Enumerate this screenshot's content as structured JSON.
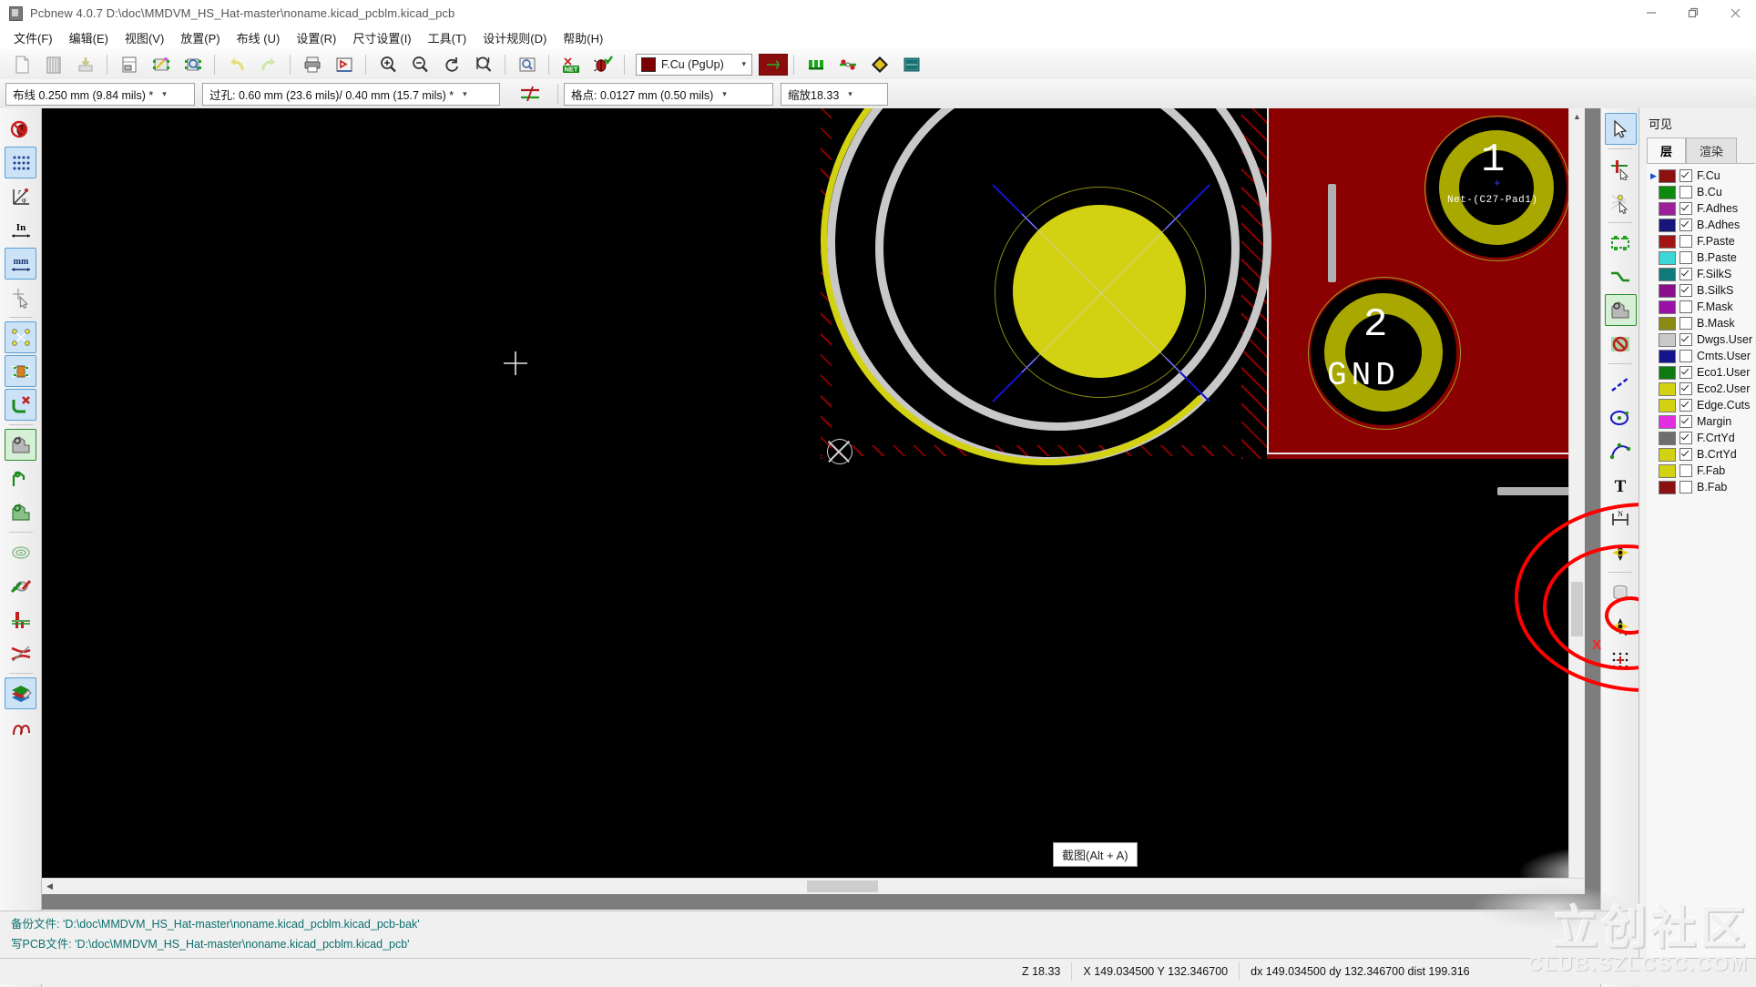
{
  "window": {
    "title": "Pcbnew 4.0.7 D:\\doc\\MMDVM_HS_Hat-master\\noname.kicad_pcblm.kicad_pcb",
    "app_icon": "pcbnew-icon",
    "buttons": [
      {
        "name": "minimize-button",
        "glyph": "minimize-icon"
      },
      {
        "name": "maximize-button",
        "glyph": "restore-icon"
      },
      {
        "name": "close-button",
        "glyph": "close-icon"
      }
    ]
  },
  "menubar": {
    "items": [
      {
        "label": "文件(F)",
        "name": "menu-file"
      },
      {
        "label": "编辑(E)",
        "name": "menu-edit"
      },
      {
        "label": "视图(V)",
        "name": "menu-view"
      },
      {
        "label": "放置(P)",
        "name": "menu-place"
      },
      {
        "label": "布线 (U)",
        "name": "menu-route"
      },
      {
        "label": "设置(R)",
        "name": "menu-preferences"
      },
      {
        "label": "尺寸设置(I)",
        "name": "menu-dimensions"
      },
      {
        "label": "工具(T)",
        "name": "menu-tools"
      },
      {
        "label": "设计规则(D)",
        "name": "menu-design-rules"
      },
      {
        "label": "帮助(H)",
        "name": "menu-help"
      }
    ]
  },
  "toolbar_main": {
    "buttons": [
      {
        "name": "new-board-button",
        "icon": "new-page-icon"
      },
      {
        "name": "open-board-button",
        "icon": "open-board-icon"
      },
      {
        "name": "save-board-button",
        "icon": "save-icon"
      },
      {
        "name": "page-settings-button",
        "icon": "page-settings-icon"
      },
      {
        "name": "open-module-editor-button",
        "icon": "module-editor-icon"
      },
      {
        "name": "open-module-viewer-button",
        "icon": "module-viewer-icon"
      },
      {
        "name": "undo-button",
        "icon": "undo-arrow-icon"
      },
      {
        "name": "redo-button",
        "icon": "redo-arrow-icon"
      },
      {
        "name": "print-button",
        "icon": "printer-icon"
      },
      {
        "name": "plot-button",
        "icon": "plot-icon"
      },
      {
        "name": "zoom-in-button",
        "icon": "zoom-in-icon"
      },
      {
        "name": "zoom-out-button",
        "icon": "zoom-out-icon"
      },
      {
        "name": "zoom-redraw-button",
        "icon": "refresh-icon"
      },
      {
        "name": "zoom-fit-button",
        "icon": "zoom-fit-icon"
      },
      {
        "name": "find-button",
        "icon": "magnifier-icon"
      },
      {
        "name": "netlist-button",
        "icon": "netlist-icon"
      },
      {
        "name": "drc-button",
        "icon": "drc-bug-icon"
      }
    ],
    "layer_selector": {
      "name": "active-layer-selector",
      "value": "F.Cu (PgUp)",
      "swatch_color": "#7c0000"
    },
    "via_color_button": {
      "name": "via-color-button",
      "color": "#8a0d0d"
    },
    "extra_buttons": [
      {
        "name": "mode-module-button",
        "icon": "module-mode-icon"
      },
      {
        "name": "mode-track-button",
        "icon": "track-mode-icon"
      },
      {
        "name": "highcontrast-button",
        "icon": "high-contrast-icon"
      },
      {
        "name": "show-ratsnest-button",
        "icon": "ratsnest-icon"
      }
    ]
  },
  "toolbar_aux": {
    "track_width": {
      "name": "track-width-selector",
      "value": "布线 0.250 mm (9.84 mils) *"
    },
    "via_size": {
      "name": "via-size-selector",
      "value": "过孔: 0.60 mm (23.6 mils)/ 0.40 mm (15.7 mils) *"
    },
    "auto_track_width_button": {
      "name": "auto-track-width-button",
      "icon": "auto-width-icon"
    },
    "grid": {
      "name": "grid-selector",
      "value": "格点: 0.0127 mm (0.50 mils)"
    },
    "zoom": {
      "name": "zoom-selector",
      "value": "缩放18.33"
    }
  },
  "left_toolbar": {
    "buttons": [
      {
        "name": "drc-disable-button",
        "icon": "drc-off-icon",
        "state": "normal"
      },
      {
        "name": "grid-toggle-button",
        "icon": "grid-dots-icon",
        "state": "active"
      },
      {
        "name": "polar-coords-button",
        "icon": "polar-coords-icon",
        "state": "normal"
      },
      {
        "name": "units-inches-button",
        "icon": "inches-icon",
        "state": "normal"
      },
      {
        "name": "units-mm-button",
        "icon": "mm-icon",
        "state": "active"
      },
      {
        "name": "cursor-shape-button",
        "icon": "cursor-crosshair-icon",
        "state": "normal"
      },
      {
        "name": "show-ratsnest-button",
        "icon": "ratsnest-nodes-icon",
        "state": "active"
      },
      {
        "name": "module-ratsnest-button",
        "icon": "module-ratsnest-icon",
        "state": "active"
      },
      {
        "name": "autoroute-disable-button",
        "icon": "autoroute-off-icon",
        "state": "active"
      },
      {
        "name": "zone-filled-button",
        "icon": "zone-filled-icon",
        "state": "activeg"
      },
      {
        "name": "zone-outline-button",
        "icon": "zone-outline-icon",
        "state": "normalg"
      },
      {
        "name": "zone-hatched-button",
        "icon": "zone-hatched-icon",
        "state": "normalg"
      },
      {
        "name": "via-sketch-button",
        "icon": "via-sketch-icon",
        "state": "normal"
      },
      {
        "name": "pad-sketch-button",
        "icon": "pad-sketch-icon",
        "state": "normal"
      },
      {
        "name": "track-sketch-button",
        "icon": "track-sketch-icon",
        "state": "normal"
      },
      {
        "name": "graphic-sketch-button",
        "icon": "graphic-sketch-icon",
        "state": "normal"
      },
      {
        "name": "contrast-mode-button",
        "icon": "layers-contrast-icon",
        "state": "active"
      },
      {
        "name": "manage-layers-button",
        "icon": "manage-layers-icon",
        "state": "normal"
      }
    ]
  },
  "right_toolbar": {
    "buttons": [
      {
        "name": "select-tool-button",
        "icon": "cursor-arrow-icon",
        "state": "active"
      },
      {
        "name": "highlight-net-button",
        "icon": "highlight-net-icon",
        "state": "normal"
      },
      {
        "name": "local-ratsnest-button",
        "icon": "local-ratsnest-icon",
        "state": "normal"
      },
      {
        "name": "add-module-button",
        "icon": "add-module-icon",
        "state": "normal"
      },
      {
        "name": "add-track-button",
        "icon": "add-track-icon",
        "state": "normal"
      },
      {
        "name": "add-zone-button",
        "icon": "add-zone-icon",
        "state": "activeg"
      },
      {
        "name": "add-keepout-button",
        "icon": "add-keepout-icon",
        "state": "normal"
      },
      {
        "name": "add-line-button",
        "icon": "add-dashed-line-icon",
        "state": "normal"
      },
      {
        "name": "add-circle-button",
        "icon": "add-circle-icon",
        "state": "normal"
      },
      {
        "name": "add-arc-button",
        "icon": "add-arc-icon",
        "state": "normal"
      },
      {
        "name": "add-text-button",
        "icon": "add-text-icon",
        "state": "normal"
      },
      {
        "name": "add-dimension-button",
        "icon": "add-dimension-icon",
        "state": "normal"
      },
      {
        "name": "add-target-button",
        "icon": "add-target-icon",
        "state": "normal"
      },
      {
        "name": "delete-tool-button",
        "icon": "trash-icon",
        "state": "normal"
      },
      {
        "name": "set-origin-button",
        "icon": "drill-origin-icon",
        "state": "normal"
      },
      {
        "name": "set-grid-origin-button",
        "icon": "grid-origin-icon",
        "state": "normal"
      }
    ]
  },
  "layers_panel": {
    "title": "可见",
    "tabs": [
      {
        "label": "层",
        "name": "tab-layers",
        "selected": true
      },
      {
        "label": "渲染",
        "name": "tab-render",
        "selected": false
      }
    ],
    "rows": [
      {
        "name": "F.Cu",
        "color": "#8b1010",
        "visible": true,
        "active": true
      },
      {
        "name": "B.Cu",
        "color": "#0d8a0d",
        "visible": false,
        "active": false
      },
      {
        "name": "F.Adhes",
        "color": "#9b1f9b",
        "visible": true,
        "active": false
      },
      {
        "name": "B.Adhes",
        "color": "#15157a",
        "visible": true,
        "active": false
      },
      {
        "name": "F.Paste",
        "color": "#a01414",
        "visible": false,
        "active": false
      },
      {
        "name": "B.Paste",
        "color": "#3ed6d6",
        "visible": false,
        "active": false
      },
      {
        "name": "F.SilkS",
        "color": "#107b7b",
        "visible": true,
        "active": false
      },
      {
        "name": "B.SilkS",
        "color": "#8b0f8b",
        "visible": true,
        "active": false
      },
      {
        "name": "F.Mask",
        "color": "#9b11a8",
        "visible": false,
        "active": false
      },
      {
        "name": "B.Mask",
        "color": "#8a8a10",
        "visible": false,
        "active": false
      },
      {
        "name": "Dwgs.User",
        "color": "#c9c9c9",
        "visible": true,
        "active": false
      },
      {
        "name": "Cmts.User",
        "color": "#14148c",
        "visible": false,
        "active": false
      },
      {
        "name": "Eco1.User",
        "color": "#0f7a0f",
        "visible": true,
        "active": false
      },
      {
        "name": "Eco2.User",
        "color": "#d2d212",
        "visible": true,
        "active": false
      },
      {
        "name": "Edge.Cuts",
        "color": "#d2d212",
        "visible": true,
        "active": false
      },
      {
        "name": "Margin",
        "color": "#e22ee2",
        "visible": true,
        "active": false
      },
      {
        "name": "F.CrtYd",
        "color": "#6e6e6e",
        "visible": true,
        "active": false
      },
      {
        "name": "B.CrtYd",
        "color": "#d2d212",
        "visible": true,
        "active": false
      },
      {
        "name": "F.Fab",
        "color": "#d2d212",
        "visible": false,
        "active": false
      },
      {
        "name": "B.Fab",
        "color": "#8b1010",
        "visible": false,
        "active": false
      }
    ]
  },
  "canvas": {
    "background": "#000000",
    "tooltip": {
      "name": "screenshot-tooltip",
      "text": "截图(Alt + A)"
    },
    "pads": [
      {
        "number": "1",
        "net": "Net-(C27-Pad1)",
        "shape": "annular-ring",
        "color": "#a8a800"
      },
      {
        "number": "2",
        "net": "GND",
        "shape": "annular-ring",
        "color": "#a8a800"
      }
    ],
    "big_pad": {
      "name": "mounting-pad",
      "color": "#d2d212"
    }
  },
  "message_panel": {
    "lines": [
      "备份文件: 'D:\\doc\\MMDVM_HS_Hat-master\\noname.kicad_pcblm.kicad_pcb-bak'",
      "写PCB文件: 'D:\\doc\\MMDVM_HS_Hat-master\\noname.kicad_pcblm.kicad_pcb'"
    ]
  },
  "statusbar": {
    "zoom": "Z 18.33",
    "absolute": "X 149.034500  Y 132.346700",
    "relative": "dx 149.034500  dy 132.346700  dist 199.316"
  },
  "watermark": {
    "cn": "立创社区",
    "en": "CLUB.SZLCSC.COM"
  },
  "annotation": {
    "marks": [
      "X",
      "X"
    ],
    "color": "#ff0000"
  }
}
